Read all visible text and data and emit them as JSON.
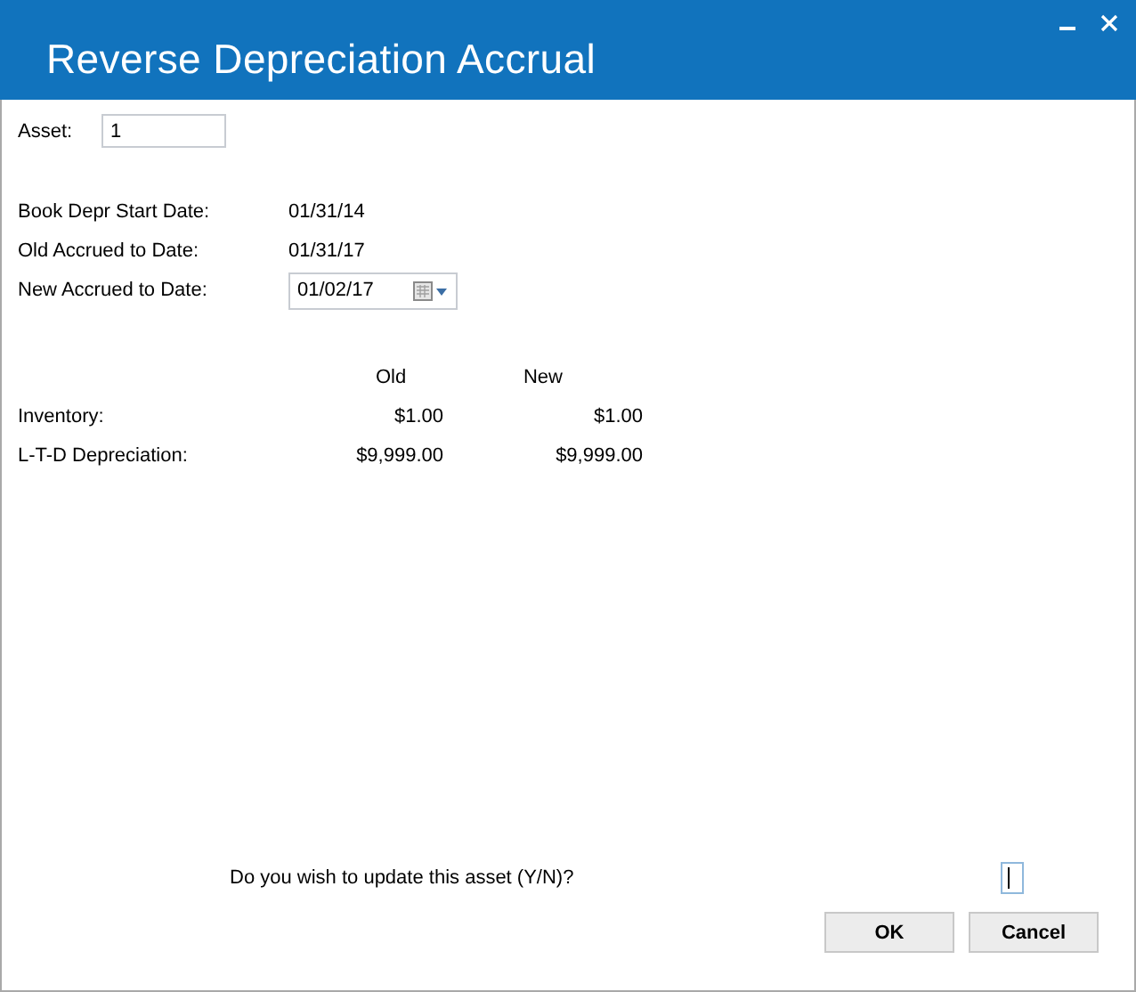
{
  "window": {
    "title": "Reverse Depreciation Accrual"
  },
  "asset": {
    "label": "Asset:",
    "value": "1"
  },
  "dates": [
    {
      "label": "Book Depr Start Date:",
      "value": "01/31/14",
      "kind": "text"
    },
    {
      "label": "Old Accrued to Date:",
      "value": "01/31/17",
      "kind": "text"
    },
    {
      "label": "New Accrued to Date:",
      "value": "01/02/17",
      "kind": "picker"
    }
  ],
  "amounts": {
    "columns": [
      "Old",
      "New"
    ],
    "rows": [
      {
        "label": "Inventory:",
        "old": "$1.00",
        "new": "$1.00"
      },
      {
        "label": "L-T-D Depreciation:",
        "old": "$9,999.00",
        "new": "$9,999.00"
      }
    ]
  },
  "prompt": {
    "question": "Do you wish to update this asset (Y/N)?"
  },
  "buttons": [
    "OK",
    "Cancel"
  ]
}
